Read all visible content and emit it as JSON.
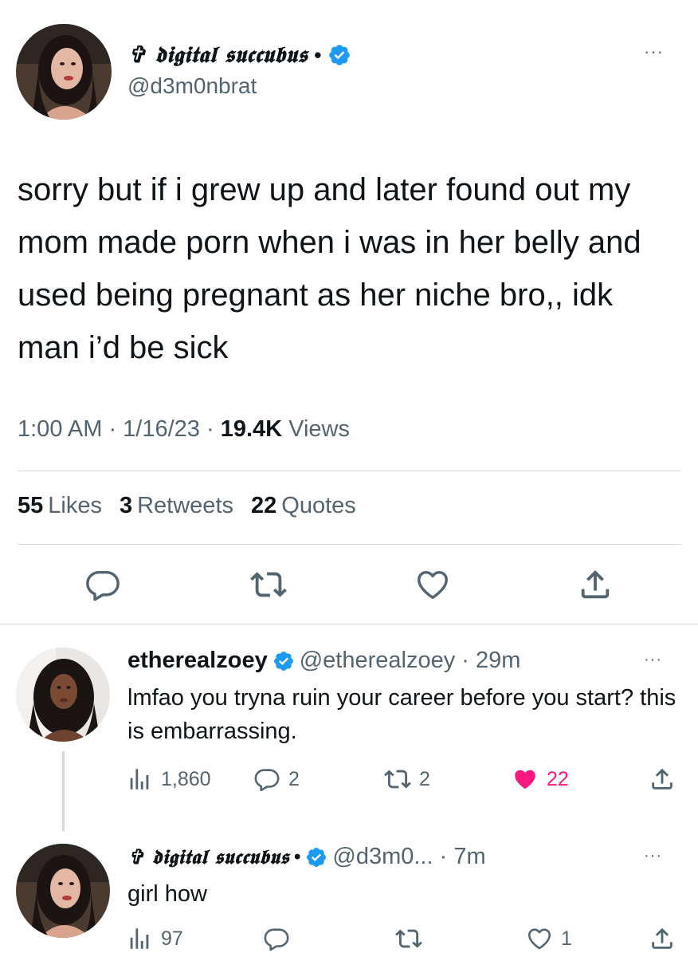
{
  "main_tweet": {
    "display_name": "✞ 𝖉𝖎𝖌𝖎𝖙𝖆𝖑 𝖘𝖚𝖈𝖈𝖚𝖇𝖚𝖘",
    "name_suffix": "•",
    "handle": "@d3m0nbrat",
    "more": "···",
    "text": "sorry but if i grew up and later found out my mom made porn when i was in her belly and used being pregnant as her niche bro,, idk man i’d be sick",
    "time": "1:00 AM · 1/16/23 · ",
    "views_count": "19.4K",
    "views_label": " Views",
    "likes_count": "55",
    "likes_label": "Likes",
    "retweets_count": "3",
    "retweets_label": "Retweets",
    "quotes_count": "22",
    "quotes_label": "Quotes"
  },
  "reply_1": {
    "display_name": "etherealzoey",
    "handle_time": "@etherealzoey · 29m",
    "more": "···",
    "text": "lmfao you tryna ruin your career before you start? this is embarrassing.",
    "views": "1,860",
    "replies": "2",
    "retweets": "2",
    "likes": "22"
  },
  "reply_2": {
    "display_name": "✞ 𝖉𝖎𝖌𝖎𝖙𝖆𝖑 𝖘𝖚𝖈𝖈𝖚𝖇𝖚𝖘",
    "name_suffix": "•",
    "handle_time": "@d3m0... · 7m",
    "more": "···",
    "text": "girl how",
    "views": "97",
    "likes": "1"
  },
  "colors": {
    "verified": "#1d9bf0",
    "secondary_text": "#536471",
    "like_active": "#f91880",
    "divider": "#cfd9de"
  },
  "icons": [
    "verified-badge-icon",
    "reply-icon",
    "retweet-icon",
    "like-icon",
    "share-icon",
    "views-icon",
    "more-icon"
  ]
}
